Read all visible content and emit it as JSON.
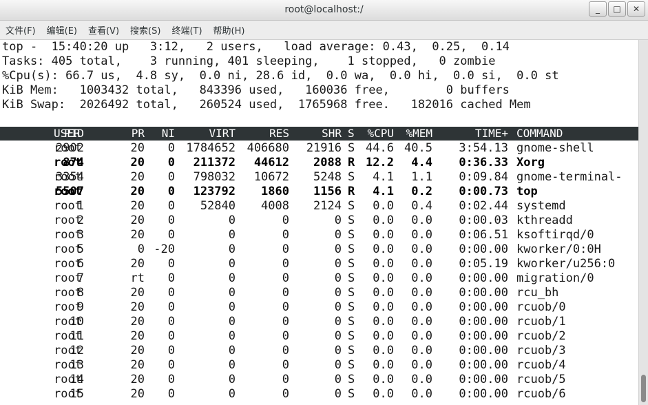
{
  "window": {
    "title": "root@localhost:/",
    "minimize": "_",
    "maximize": "□",
    "close": "✕"
  },
  "menu": [
    "文件(F)",
    "编辑(E)",
    "查看(V)",
    "搜索(S)",
    "终端(T)",
    "帮助(H)"
  ],
  "summary": {
    "line1": "top -  15:40:20 up   3:12,   2 users,   load average: 0.43,  0.25,  0.14",
    "line2": "Tasks: 405 total,    3 running, 401 sleeping,    1 stopped,   0 zombie",
    "line3": "%Cpu(s): 66.7 us,  4.8 sy,  0.0 ni, 28.6 id,  0.0 wa,  0.0 hi,  0.0 si,  0.0 st",
    "line4": "KiB Mem:   1003432 total,   843396 used,   160036 free,        0 buffers",
    "line5": "KiB Swap:  2026492 total,   260524 used,  1765968 free.   182016 cached Mem"
  },
  "columns": [
    "PID",
    "USER",
    "PR",
    "NI",
    "VIRT",
    "RES",
    "SHR",
    "S",
    "%CPU",
    "%MEM",
    "TIME+",
    "COMMAND"
  ],
  "processes": [
    {
      "pid": "2902",
      "user": "root",
      "pr": "20",
      "ni": "0",
      "virt": "1784652",
      "res": "406680",
      "shr": "21916",
      "s": "S",
      "cpu": "44.6",
      "mem": "40.5",
      "time": "3:54.13",
      "cmd": "gnome-shell",
      "bold": false
    },
    {
      "pid": "874",
      "user": "root",
      "pr": "20",
      "ni": "0",
      "virt": "211372",
      "res": "44612",
      "shr": "2088",
      "s": "R",
      "cpu": "12.2",
      "mem": "4.4",
      "time": "0:36.33",
      "cmd": "Xorg",
      "bold": true
    },
    {
      "pid": "3354",
      "user": "root",
      "pr": "20",
      "ni": "0",
      "virt": "798032",
      "res": "10672",
      "shr": "5248",
      "s": "S",
      "cpu": "4.1",
      "mem": "1.1",
      "time": "0:09.84",
      "cmd": "gnome-terminal-",
      "bold": false
    },
    {
      "pid": "5507",
      "user": "root",
      "pr": "20",
      "ni": "0",
      "virt": "123792",
      "res": "1860",
      "shr": "1156",
      "s": "R",
      "cpu": "4.1",
      "mem": "0.2",
      "time": "0:00.73",
      "cmd": "top",
      "bold": true
    },
    {
      "pid": "1",
      "user": "root",
      "pr": "20",
      "ni": "0",
      "virt": "52840",
      "res": "4008",
      "shr": "2124",
      "s": "S",
      "cpu": "0.0",
      "mem": "0.4",
      "time": "0:02.44",
      "cmd": "systemd",
      "bold": false
    },
    {
      "pid": "2",
      "user": "root",
      "pr": "20",
      "ni": "0",
      "virt": "0",
      "res": "0",
      "shr": "0",
      "s": "S",
      "cpu": "0.0",
      "mem": "0.0",
      "time": "0:00.03",
      "cmd": "kthreadd",
      "bold": false
    },
    {
      "pid": "3",
      "user": "root",
      "pr": "20",
      "ni": "0",
      "virt": "0",
      "res": "0",
      "shr": "0",
      "s": "S",
      "cpu": "0.0",
      "mem": "0.0",
      "time": "0:06.51",
      "cmd": "ksoftirqd/0",
      "bold": false
    },
    {
      "pid": "5",
      "user": "root",
      "pr": "0",
      "ni": "-20",
      "virt": "0",
      "res": "0",
      "shr": "0",
      "s": "S",
      "cpu": "0.0",
      "mem": "0.0",
      "time": "0:00.00",
      "cmd": "kworker/0:0H",
      "bold": false
    },
    {
      "pid": "6",
      "user": "root",
      "pr": "20",
      "ni": "0",
      "virt": "0",
      "res": "0",
      "shr": "0",
      "s": "S",
      "cpu": "0.0",
      "mem": "0.0",
      "time": "0:05.19",
      "cmd": "kworker/u256:0",
      "bold": false
    },
    {
      "pid": "7",
      "user": "root",
      "pr": "rt",
      "ni": "0",
      "virt": "0",
      "res": "0",
      "shr": "0",
      "s": "S",
      "cpu": "0.0",
      "mem": "0.0",
      "time": "0:00.00",
      "cmd": "migration/0",
      "bold": false
    },
    {
      "pid": "8",
      "user": "root",
      "pr": "20",
      "ni": "0",
      "virt": "0",
      "res": "0",
      "shr": "0",
      "s": "S",
      "cpu": "0.0",
      "mem": "0.0",
      "time": "0:00.00",
      "cmd": "rcu_bh",
      "bold": false
    },
    {
      "pid": "9",
      "user": "root",
      "pr": "20",
      "ni": "0",
      "virt": "0",
      "res": "0",
      "shr": "0",
      "s": "S",
      "cpu": "0.0",
      "mem": "0.0",
      "time": "0:00.00",
      "cmd": "rcuob/0",
      "bold": false
    },
    {
      "pid": "10",
      "user": "root",
      "pr": "20",
      "ni": "0",
      "virt": "0",
      "res": "0",
      "shr": "0",
      "s": "S",
      "cpu": "0.0",
      "mem": "0.0",
      "time": "0:00.00",
      "cmd": "rcuob/1",
      "bold": false
    },
    {
      "pid": "11",
      "user": "root",
      "pr": "20",
      "ni": "0",
      "virt": "0",
      "res": "0",
      "shr": "0",
      "s": "S",
      "cpu": "0.0",
      "mem": "0.0",
      "time": "0:00.00",
      "cmd": "rcuob/2",
      "bold": false
    },
    {
      "pid": "12",
      "user": "root",
      "pr": "20",
      "ni": "0",
      "virt": "0",
      "res": "0",
      "shr": "0",
      "s": "S",
      "cpu": "0.0",
      "mem": "0.0",
      "time": "0:00.00",
      "cmd": "rcuob/3",
      "bold": false
    },
    {
      "pid": "13",
      "user": "root",
      "pr": "20",
      "ni": "0",
      "virt": "0",
      "res": "0",
      "shr": "0",
      "s": "S",
      "cpu": "0.0",
      "mem": "0.0",
      "time": "0:00.00",
      "cmd": "rcuob/4",
      "bold": false
    },
    {
      "pid": "14",
      "user": "root",
      "pr": "20",
      "ni": "0",
      "virt": "0",
      "res": "0",
      "shr": "0",
      "s": "S",
      "cpu": "0.0",
      "mem": "0.0",
      "time": "0:00.00",
      "cmd": "rcuob/5",
      "bold": false
    },
    {
      "pid": "15",
      "user": "root",
      "pr": "20",
      "ni": "0",
      "virt": "0",
      "res": "0",
      "shr": "0",
      "s": "S",
      "cpu": "0.0",
      "mem": "0.0",
      "time": "0:00.00",
      "cmd": "rcuob/6",
      "bold": false
    }
  ],
  "colors": {
    "header_bg": "#2e3436",
    "header_fg": "#ffffff",
    "text": "#1a1a1a"
  }
}
